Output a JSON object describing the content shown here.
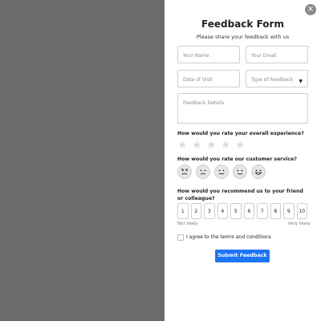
{
  "form": {
    "close_icon": "×",
    "title": "Feedback Form",
    "subtitle": "Please share your feedback with us",
    "fields": {
      "name_placeholder": "Your Name",
      "email_placeholder": "Your Email",
      "date_placeholder": "Date of Visit",
      "type_placeholder": "Type of Feedback",
      "details_placeholder": "Feedback Details"
    },
    "questions": {
      "overall": "How would you rate your overall experience?",
      "service": "How would you rate our customer service?",
      "recommend": "How would you recommend us to your friend or colleague?"
    },
    "stars": [
      "★",
      "★",
      "★",
      "★",
      "★"
    ],
    "faces": [
      "very-angry-face-icon",
      "sad-face-icon",
      "neutral-face-icon",
      "smile-face-icon",
      "very-happy-face-icon"
    ],
    "nps": {
      "values": [
        "1",
        "2",
        "3",
        "4",
        "5",
        "6",
        "7",
        "8",
        "9",
        "10"
      ],
      "min_label": "Not likely",
      "max_label": "Very likely"
    },
    "agree_label": "I agree to the terms and conditions",
    "submit_label": "Submit Feedback",
    "colors": {
      "primary": "#1d74f5",
      "overlay": "#6b6b6b"
    }
  }
}
